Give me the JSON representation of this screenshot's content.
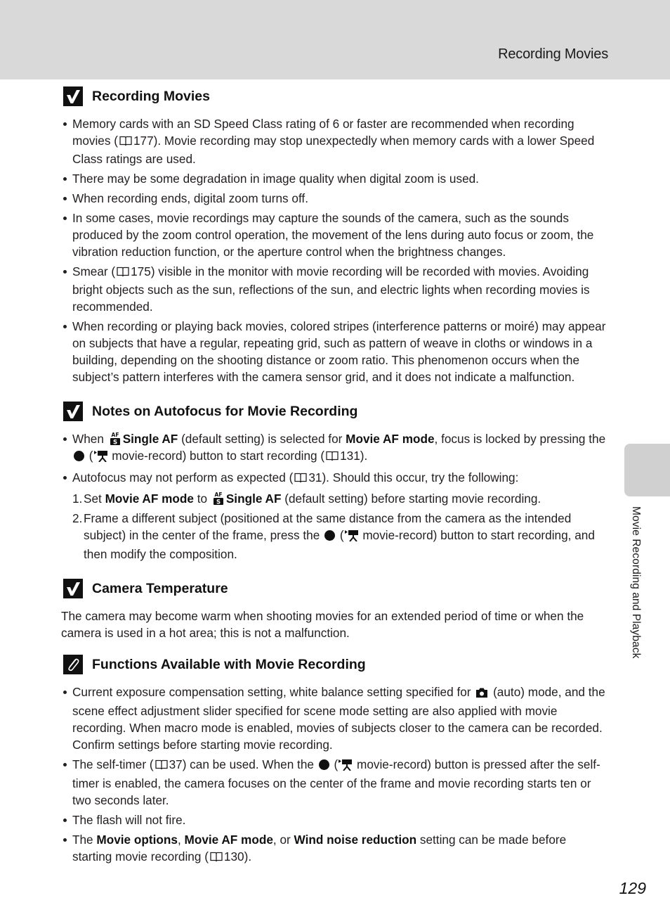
{
  "header": {
    "running_head": "Recording Movies"
  },
  "side_tab": {
    "label": "Movie Recording and Playback"
  },
  "page_number": "129",
  "sections": [
    {
      "title": "Recording Movies",
      "icon": "check-note-icon",
      "bullets": [
        {
          "a": "Memory cards with an SD Speed Class rating of 6 or faster are recommended when recording movies (",
          "ref": "177",
          "b": "). Movie recording may stop unexpectedly when memory cards with a lower Speed Class ratings are used."
        },
        {
          "a": "There may be some degradation in image quality when digital zoom is used."
        },
        {
          "a": "When recording ends, digital zoom turns off."
        },
        {
          "a": "In some cases, movie recordings may capture the sounds of the camera, such as the sounds produced by the zoom control operation, the movement of the lens during auto focus or zoom, the vibration reduction function, or the aperture control when the brightness changes."
        },
        {
          "a": "Smear (",
          "ref": "175",
          "b": ") visible in the monitor with movie recording will be recorded with movies. Avoiding bright objects such as the sun, reflections of the sun, and electric lights when recording movies is recommended."
        },
        {
          "a": "When recording or playing back movies, colored stripes (interference patterns or moiré) may appear on subjects that have a regular, repeating grid, such as pattern of weave in cloths or windows in a building, depending on the shooting distance or zoom ratio. This phenomenon occurs when the subject’s pattern interferes with the camera sensor grid, and it does not indicate a malfunction."
        }
      ]
    },
    {
      "title": "Notes on Autofocus for Movie Recording",
      "icon": "check-note-icon",
      "b1": {
        "t1": "When ",
        "bold1": "Single AF",
        "t2": " (default setting) is selected for ",
        "bold2": "Movie AF mode",
        "t3": ", focus is locked by pressing the ",
        "t4": " (",
        "t5": " movie-record) button to start recording (",
        "ref": "131",
        "t6": ")."
      },
      "b2": {
        "t1": "Autofocus may not perform as expected (",
        "ref": "31",
        "t2": "). Should this occur, try the following:"
      },
      "steps": [
        {
          "num": "1.",
          "t1": "Set ",
          "bold1": "Movie AF mode",
          "t2": " to ",
          "bold2": "Single AF",
          "t3": " (default setting) before starting movie recording."
        },
        {
          "num": "2.",
          "t1": "Frame a different subject (positioned at the same distance from the camera as the intended subject) in the center of the frame, press the ",
          "t2": " (",
          "t3": " movie-record) button to start recording, and then modify the composition."
        }
      ]
    },
    {
      "title": "Camera Temperature",
      "icon": "check-note-icon",
      "text": "The camera may become warm when shooting movies for an extended period of time or when the camera is used in a hot area; this is not a malfunction."
    },
    {
      "title": "Functions Available with Movie Recording",
      "icon": "paperclip-note-icon",
      "b1": {
        "t1": "Current exposure compensation setting, white balance setting specified for ",
        "t2": " (auto) mode, and the scene effect adjustment slider specified for scene mode setting are also applied with movie recording. When macro mode is enabled, movies of subjects closer to the camera can be recorded. Confirm settings before starting movie recording."
      },
      "b2": {
        "t1": "The self-timer (",
        "ref": "37",
        "t2": ") can be used. When the ",
        "t3": " (",
        "t4": " movie-record) button is pressed after the self-timer is enabled, the camera focuses on the center of the frame and movie recording starts ten or two seconds later."
      },
      "b3": {
        "t1": "The flash will not fire."
      },
      "b4": {
        "t1": "The ",
        "bold1": "Movie options",
        "t2": ", ",
        "bold2": "Movie AF mode",
        "t3": ", or ",
        "bold3": "Wind noise reduction",
        "t4": " setting can be made before starting movie recording (",
        "ref": "130",
        "t5": ")."
      }
    }
  ]
}
